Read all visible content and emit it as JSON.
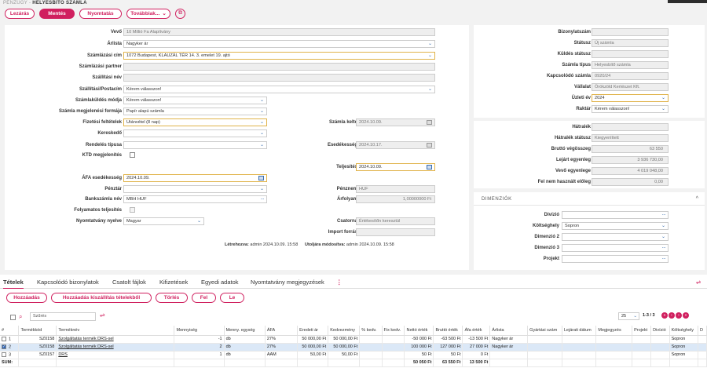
{
  "breadcrumb": {
    "section": "PÉNZÜGY",
    "sep": " - ",
    "page": "HELYESBÍTŐ SZÁMLA"
  },
  "toolbar": {
    "close": "Lezárás",
    "save": "Mentés",
    "print": "Nyomtatás",
    "more": "Továbbiak...",
    "more_icon": "chevron-down-icon",
    "copy_icon": "copy-icon"
  },
  "left": {
    "vevo": {
      "label": "Vevő",
      "value": "10 Millió Fa Alapítvány"
    },
    "arlista": {
      "label": "Árlista",
      "value": "Nagyker ár"
    },
    "szamlazasi_cim": {
      "label": "Számlázási cím",
      "value": "1072 Budapest, KLAUZÁL TÉR 14. 3. emelet 19. ajtó"
    },
    "szamlazasi_partner": {
      "label": "Számlázási partner",
      "value": ""
    },
    "szallitasi_nev": {
      "label": "Szállítási név",
      "value": ""
    },
    "szallitasi_postacim": {
      "label": "Szállítási/Postacím",
      "value": "Kérem válasszon!"
    },
    "szamlakuldes": {
      "label": "Számlaküldés módja",
      "value": "Kérem válasszon!"
    },
    "megjelenesi": {
      "label": "Számla megjelenési formája",
      "value": "Papír alapú számla"
    },
    "fizetesi": {
      "label": "Fizetési feltételek",
      "value": "Utánvétel (8 nap)"
    },
    "kereskedo": {
      "label": "Kereskedő",
      "value": ""
    },
    "rendeles": {
      "label": "Rendelés típusa",
      "value": ""
    },
    "ktd": {
      "label": "KTD megjelenítés"
    },
    "afa_esed": {
      "label": "ÁFA esedékesség",
      "value": "2024.10.09."
    },
    "penztar": {
      "label": "Pénztár",
      "value": ""
    },
    "bankszamla": {
      "label": "Bankszámla név",
      "value": "MBH HUF"
    },
    "folyamatos": {
      "label": "Folyamatos teljesítés"
    },
    "nyelv": {
      "label": "Nyomtatvány nyelve",
      "value": "Magyar"
    },
    "szamla_kelte": {
      "label": "Számla kelte",
      "value": "2024.10.09."
    },
    "esedekesseg": {
      "label": "Esedékesség",
      "value": "2024.10.17."
    },
    "teljesites": {
      "label": "Teljesítés",
      "value": "2024.10.09."
    },
    "penznem": {
      "label": "Pénznem",
      "value": "HUF"
    },
    "arfolyam": {
      "label": "Árfolyam",
      "value": "1,00000000 Ft"
    },
    "csatorna": {
      "label": "Csatorna",
      "value": "Értékesítőn keresztül"
    },
    "import": {
      "label": "Import forrás",
      "value": ""
    },
    "created_label": "Létrehozva:",
    "created_value": "admin 2024.10.09. 15:58",
    "modified_label": "Utoljára módosítva:",
    "modified_value": "admin 2024.10.09. 15:58"
  },
  "right": {
    "bizonylatszam": {
      "label": "Bizonylatszám",
      "value": ""
    },
    "statusz": {
      "label": "Státusz",
      "value": "Új számla"
    },
    "kuldes": {
      "label": "Küldés státusz",
      "value": ""
    },
    "tipus": {
      "label": "Számla típus",
      "value": "Helyesbítő számla"
    },
    "kapcsolodo": {
      "label": "Kapcsolódó számla",
      "value": "0920/24"
    },
    "vallalat": {
      "label": "Vállalat",
      "value": "Örökzöld Kertészet Kft."
    },
    "uzleti_ev": {
      "label": "Üzleti év",
      "value": "2024"
    },
    "raktar": {
      "label": "Raktár",
      "value": "Kérem válasszon!"
    },
    "hatralek": {
      "label": "Hátralék",
      "value": ""
    },
    "hatralek_statusz": {
      "label": "Hátralék státusz",
      "value": "Kiegyenlített"
    },
    "brutto": {
      "label": "Bruttó végösszeg",
      "value": "63 550"
    },
    "lejart": {
      "label": "Lejárt egyenleg",
      "value": "3 936 730,00"
    },
    "vevo_egyenleg": {
      "label": "Vevő egyenlege",
      "value": "4 019 048,00"
    },
    "fel_nem": {
      "label": "Fel nem használt előleg",
      "value": "0,00"
    },
    "dim_title": "DIMENZIÓK",
    "divizio": {
      "label": "Divízió",
      "value": ""
    },
    "koltseghely": {
      "label": "Költséghely",
      "value": "Sopron"
    },
    "dim2": {
      "label": "Dimenzió 2",
      "value": ""
    },
    "dim3": {
      "label": "Dimenzió 3",
      "value": ""
    },
    "projekt": {
      "label": "Projekt",
      "value": ""
    }
  },
  "tabs": [
    "Tételek",
    "Kapcsolódó bizonylatok",
    "Csatolt fájlok",
    "Kifizetések",
    "Egyedi adatok",
    "Nyomtatvány megjegyzések"
  ],
  "grid": {
    "buttons": [
      "Hozzáadás",
      "Hozzáadás kiszállítás tételekből",
      "Törlés",
      "Fel",
      "Le"
    ],
    "filter_placeholder": "Szűrés",
    "page_size": "25",
    "pager": "1-3 / 3",
    "columns": [
      "#",
      "Termékkód",
      "Terméknév",
      "Mennyiség",
      "Menny. egység",
      "ÁFA",
      "Eredeti ár",
      "Kedvezmény",
      "% kedv.",
      "Fix kedv.",
      "Nettó érték",
      "Bruttó érték",
      "Áfa érték",
      "Árlista",
      "Gyártási szám",
      "Lejárati dátum",
      "Megjegyzés",
      "Projekt",
      "Divízió",
      "Költséghely",
      "D"
    ],
    "rows": [
      {
        "n": "1",
        "code": "SZ0158",
        "name": "Szolgáltatás termék DRS-sel",
        "qty": "-1",
        "unit": "db",
        "vat": "27%",
        "orig": "50 000,00 Ft",
        "disc": "50 000,00 Ft",
        "pct": "",
        "fix": "",
        "net": "-50 000 Ft",
        "gross": "-63 500 Ft",
        "vatv": "-13 500 Ft",
        "pl": "Nagyker ár",
        "cost": "Sopron",
        "sel": false
      },
      {
        "n": "2",
        "code": "SZ0158",
        "name": "Szolgáltatás termék DRS-sel",
        "qty": "2",
        "unit": "db",
        "vat": "27%",
        "orig": "50 000,00 Ft",
        "disc": "50 000,00 Ft",
        "pct": "",
        "fix": "",
        "net": "100 000 Ft",
        "gross": "127 000 Ft",
        "vatv": "27 000 Ft",
        "pl": "Nagyker ár",
        "cost": "Sopron",
        "sel": true
      },
      {
        "n": "3",
        "code": "SZ0157",
        "name": "DRS",
        "qty": "1",
        "unit": "db",
        "vat": "AAM",
        "orig": "50,00 Ft",
        "disc": "50,00 Ft",
        "pct": "",
        "fix": "",
        "net": "50 Ft",
        "gross": "50 Ft",
        "vatv": "0 Ft",
        "pl": "",
        "cost": "Sopron",
        "sel": false
      }
    ],
    "sum": {
      "label": "SUM:",
      "net": "50 050 Ft",
      "gross": "63 550 Ft",
      "vat": "13 500 Ft"
    }
  },
  "colors": {
    "accent": "#d0205f",
    "link": "#3a6fb0",
    "highlight": "#e0b34a"
  }
}
